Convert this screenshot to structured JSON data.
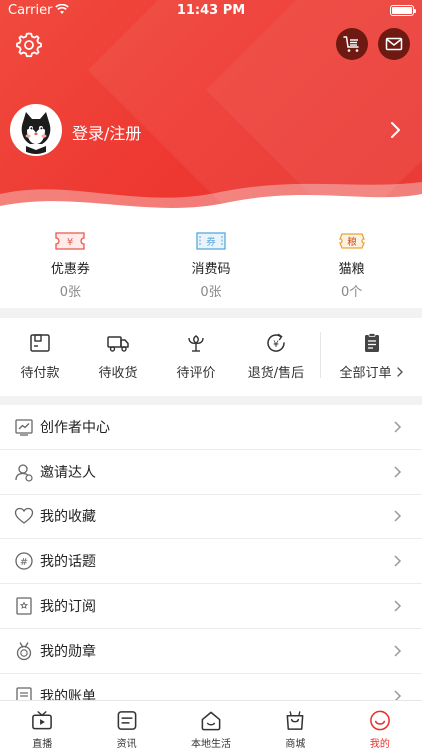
{
  "status_bar": {
    "carrier": "Carrier",
    "time": "11:43 PM"
  },
  "profile": {
    "login_text": "登录/注册"
  },
  "cards": [
    {
      "icon": "coupon-icon",
      "glyph": "¥",
      "label": "优惠券",
      "value": "0张"
    },
    {
      "icon": "voucher-code-icon",
      "glyph": "券",
      "label": "消费码",
      "value": "0张"
    },
    {
      "icon": "cat-food-icon",
      "glyph": "粮",
      "label": "猫粮",
      "value": "0个"
    }
  ],
  "orders": {
    "items": [
      {
        "icon": "wallet-icon",
        "label": "待付款"
      },
      {
        "icon": "truck-icon",
        "label": "待收货"
      },
      {
        "icon": "flower-icon",
        "label": "待评价"
      },
      {
        "icon": "refund-icon",
        "label": "退货/售后"
      }
    ],
    "all_label": "全部订单"
  },
  "menu": [
    {
      "icon": "chart-icon",
      "label": "创作者中心"
    },
    {
      "icon": "invite-user-icon",
      "label": "邀请达人"
    },
    {
      "icon": "heart-icon",
      "label": "我的收藏"
    },
    {
      "icon": "hashtag-icon",
      "label": "我的话题"
    },
    {
      "icon": "bookmark-icon",
      "label": "我的订阅"
    },
    {
      "icon": "medal-icon",
      "label": "我的勋章"
    },
    {
      "icon": "bill-icon",
      "label": "我的账单"
    }
  ],
  "tabbar": [
    {
      "icon": "tv-icon",
      "label": "直播"
    },
    {
      "icon": "news-icon",
      "label": "资讯"
    },
    {
      "icon": "home-icon",
      "label": "本地生活"
    },
    {
      "icon": "shopping-bag-icon",
      "label": "商城"
    },
    {
      "icon": "smile-icon",
      "label": "我的",
      "active": true
    }
  ],
  "colors": {
    "brand": "#e8312b",
    "brand_light": "#f04a3e",
    "card_red": "#e8574c",
    "card_blue": "#5aa7d8",
    "card_orange": "#e9a23b"
  }
}
